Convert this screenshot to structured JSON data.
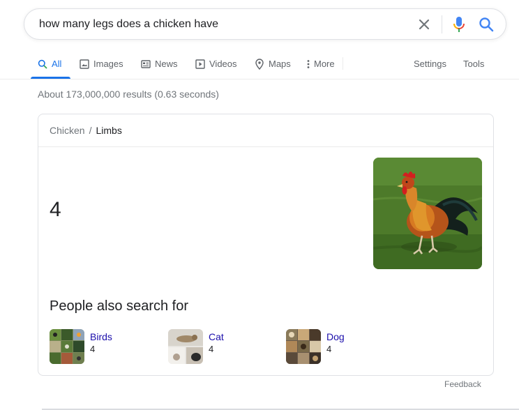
{
  "search": {
    "query": "how many legs does a chicken have"
  },
  "tabs": [
    {
      "label": "All",
      "icon": "search-icon",
      "active": true
    },
    {
      "label": "Images",
      "icon": "image-icon"
    },
    {
      "label": "News",
      "icon": "news-icon"
    },
    {
      "label": "Videos",
      "icon": "video-icon"
    },
    {
      "label": "Maps",
      "icon": "map-pin-icon"
    },
    {
      "label": "More",
      "icon": "more-vert-icon"
    }
  ],
  "tools": {
    "settings_label": "Settings",
    "tools_label": "Tools"
  },
  "result_stats": "About 173,000,000 results (0.63 seconds)",
  "answer_card": {
    "breadcrumb": [
      "Chicken",
      "Limbs"
    ],
    "breadcrumb_separator": "/",
    "answer": "4",
    "people_also_search_title": "People also search for",
    "related": [
      {
        "name": "Birds",
        "value": "4"
      },
      {
        "name": "Cat",
        "value": "4"
      },
      {
        "name": "Dog",
        "value": "4"
      }
    ]
  },
  "feedback_label": "Feedback",
  "colors": {
    "accent": "#1a73e8",
    "link": "#1a0dab",
    "muted": "#70757a"
  }
}
